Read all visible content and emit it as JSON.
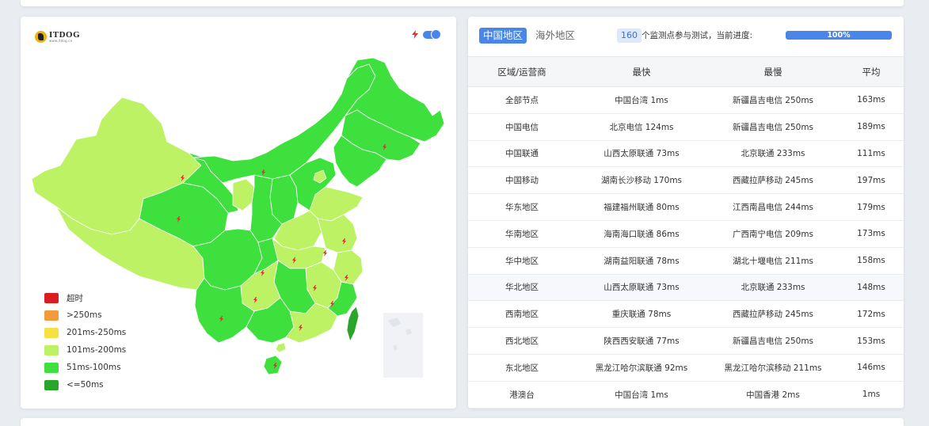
{
  "map": {
    "logo_text": "ITDOG",
    "logo_sub": "www.itdog.cn",
    "legend": [
      {
        "label": "超时",
        "color": "#d81e1e"
      },
      {
        "label": ">250ms",
        "color": "#f29b3d"
      },
      {
        "label": "201ms-250ms",
        "color": "#f5e142"
      },
      {
        "label": "101ms-200ms",
        "color": "#bdf264"
      },
      {
        "label": "51ms-100ms",
        "color": "#3ee03e"
      },
      {
        "label": "<=50ms",
        "color": "#2aa52a"
      }
    ],
    "colors": {
      "light": "#bdf264",
      "mid": "#3ee03e",
      "dark": "#2aa52a",
      "border": "#ffffff",
      "marker": "#e33030"
    }
  },
  "results": {
    "tabs": [
      "中国地区",
      "海外地区"
    ],
    "node_count": "160",
    "count_text": "个监测点参与测试，当前进度:",
    "progress_label": "100%",
    "progress": 1.0,
    "columns": [
      "区域/运营商",
      "最快",
      "最慢",
      "平均"
    ],
    "rows": [
      [
        "全部节点",
        "中国台湾 1ms",
        "新疆昌吉电信 250ms",
        "163ms"
      ],
      [
        "中国电信",
        "北京电信 124ms",
        "新疆昌吉电信 250ms",
        "189ms"
      ],
      [
        "中国联通",
        "山西太原联通 73ms",
        "北京联通 233ms",
        "111ms"
      ],
      [
        "中国移动",
        "湖南长沙移动 170ms",
        "西藏拉萨移动 245ms",
        "197ms"
      ],
      [
        "华东地区",
        "福建福州联通 80ms",
        "江西南昌电信 244ms",
        "179ms"
      ],
      [
        "华南地区",
        "海南海口联通 86ms",
        "广西南宁电信 209ms",
        "173ms"
      ],
      [
        "华中地区",
        "湖南益阳联通 78ms",
        "湖北十堰电信 211ms",
        "158ms"
      ],
      [
        "华北地区",
        "山西太原联通 73ms",
        "北京联通 233ms",
        "148ms"
      ],
      [
        "西南地区",
        "重庆联通 78ms",
        "西藏拉萨移动 245ms",
        "172ms"
      ],
      [
        "西北地区",
        "陕西西安联通 77ms",
        "新疆昌吉电信 250ms",
        "153ms"
      ],
      [
        "东北地区",
        "黑龙江哈尔滨联通 92ms",
        "黑龙江哈尔滨移动 211ms",
        "146ms"
      ],
      [
        "港澳台",
        "中国台湾 1ms",
        "中国香港 2ms",
        "1ms"
      ]
    ]
  }
}
